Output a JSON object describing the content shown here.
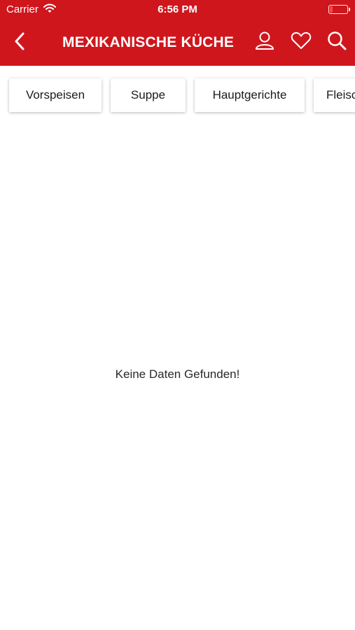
{
  "status_bar": {
    "carrier": "Carrier",
    "time": "6:56 PM",
    "battery_level": 0.15
  },
  "header": {
    "title": "MEXIKANISCHE KÜCHE",
    "background_color": "#d0161d",
    "icons": [
      "back-chevron-icon",
      "profile-icon",
      "heart-icon",
      "search-icon"
    ]
  },
  "category_tabs": [
    {
      "label": "Vorspeisen"
    },
    {
      "label": "Suppe"
    },
    {
      "label": "Hauptgerichte"
    },
    {
      "label": "Fleisch"
    }
  ],
  "main": {
    "empty_message": "Keine Daten Gefunden!"
  }
}
